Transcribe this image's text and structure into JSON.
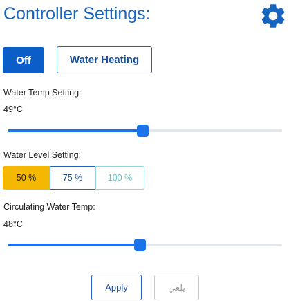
{
  "header": {
    "title": "Controller Settings:",
    "settings_icon": "gear-icon"
  },
  "mode": {
    "off_label": "Off",
    "water_heating_label": "Water Heating"
  },
  "water_temp": {
    "label": "Water Temp Setting:",
    "value": "49°C",
    "fill_fraction": 0.49
  },
  "water_level": {
    "label": "Water Level Setting:",
    "options": [
      "50 %",
      "75 %",
      "100 %"
    ],
    "selected": "50 %"
  },
  "circulating_temp": {
    "label": "Circulating Water Temp:",
    "value": "48°C",
    "fill_fraction": 0.48
  },
  "actions": {
    "apply_label": "Apply",
    "cancel_label": "يلغي"
  },
  "colors": {
    "title": "#1565c0",
    "primary": "#0b5ec7",
    "slider": "#1a73e8",
    "selected_level": "#f5b800",
    "disabled_level": "#6cc3c7"
  }
}
